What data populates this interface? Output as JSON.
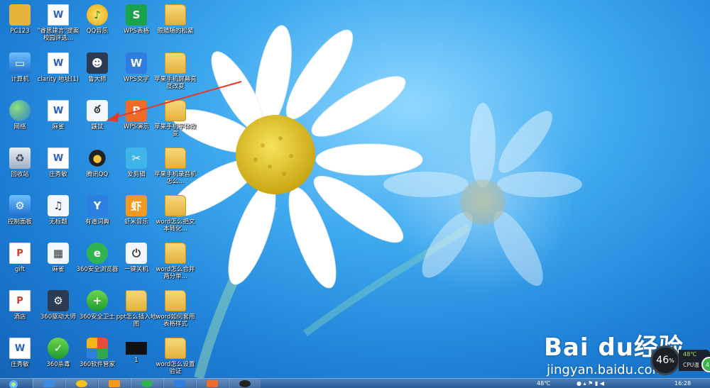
{
  "desktop": {
    "icons": [
      {
        "label": "PC123",
        "glyph": "pc",
        "symbol": "",
        "icon_name": "folder-icon"
      },
      {
        "label": "\"睿思建言\"提案校园评选...",
        "glyph": "doc-w",
        "symbol": "W",
        "icon_name": "word-document-icon"
      },
      {
        "label": "QQ音乐",
        "glyph": "qq",
        "symbol": "♪",
        "icon_name": "qq-music-icon"
      },
      {
        "label": "WPS表格",
        "glyph": "wps-s",
        "symbol": "S",
        "icon_name": "wps-spreadsheet-icon"
      },
      {
        "label": "眼睛随的松紧",
        "glyph": "folder",
        "symbol": "",
        "icon_name": "folder-icon"
      },
      {
        "label": "计算机",
        "glyph": "comp",
        "symbol": "▭",
        "icon_name": "computer-icon"
      },
      {
        "label": "clarity 地址(1)",
        "glyph": "doc-w",
        "symbol": "W",
        "icon_name": "word-document-icon"
      },
      {
        "label": "鲁大师",
        "glyph": "dark",
        "symbol": "☻",
        "icon_name": "ludashi-icon"
      },
      {
        "label": "WPS文字",
        "glyph": "wps-w",
        "symbol": "W",
        "icon_name": "wps-writer-icon"
      },
      {
        "label": "苹果手机屏幕亮度改变",
        "glyph": "folder",
        "symbol": "",
        "icon_name": "folder-icon"
      },
      {
        "label": "网络",
        "glyph": "globe",
        "symbol": "",
        "icon_name": "network-icon"
      },
      {
        "label": "麻雀",
        "glyph": "doc-w",
        "symbol": "W",
        "icon_name": "word-document-icon"
      },
      {
        "label": "鼷鼠",
        "glyph": "white",
        "symbol": "ఠ",
        "icon_name": "mouse-app-icon"
      },
      {
        "label": "WPS演示",
        "glyph": "wps-p",
        "symbol": "P",
        "icon_name": "wps-presentation-icon"
      },
      {
        "label": "苹果手机字体改变",
        "glyph": "folder",
        "symbol": "",
        "icon_name": "folder-icon"
      },
      {
        "label": "回收站",
        "glyph": "bin",
        "symbol": "♻",
        "icon_name": "recycle-bin-icon"
      },
      {
        "label": "庄秀敏",
        "glyph": "doc-w",
        "symbol": "W",
        "icon_name": "word-document-icon"
      },
      {
        "label": "腾讯QQ",
        "glyph": "penguin",
        "symbol": "●",
        "icon_name": "qq-penguin-icon"
      },
      {
        "label": "爱剪辑",
        "glyph": "cyan",
        "symbol": "✂",
        "icon_name": "video-editor-icon"
      },
      {
        "label": "苹果手机录音机怎么...",
        "glyph": "folder",
        "symbol": "",
        "icon_name": "folder-icon"
      },
      {
        "label": "控制面板",
        "glyph": "comp",
        "symbol": "⚙",
        "icon_name": "control-panel-icon"
      },
      {
        "label": "无标题",
        "glyph": "white",
        "symbol": "♫",
        "icon_name": "audio-file-icon"
      },
      {
        "label": "有道词典",
        "glyph": "blue2",
        "symbol": "Y",
        "icon_name": "youdao-dictionary-icon"
      },
      {
        "label": "虾米音乐",
        "glyph": "orange",
        "symbol": "虾",
        "icon_name": "xiami-music-icon"
      },
      {
        "label": "word怎么把文本转化...",
        "glyph": "folder",
        "symbol": "",
        "icon_name": "folder-icon"
      },
      {
        "label": "gift",
        "glyph": "doc-p",
        "symbol": "P",
        "icon_name": "presentation-document-icon"
      },
      {
        "label": "麻雀",
        "glyph": "white",
        "symbol": "▦",
        "icon_name": "image-file-icon"
      },
      {
        "label": "360安全浏览器",
        "glyph": "green",
        "symbol": "e",
        "icon_name": "browser-icon"
      },
      {
        "label": "一键关机",
        "glyph": "white",
        "symbol": "⏻",
        "icon_name": "shutdown-shortcut-icon"
      },
      {
        "label": "word怎么合并两分单...",
        "glyph": "folder",
        "symbol": "",
        "icon_name": "folder-icon"
      },
      {
        "label": "酒店",
        "glyph": "doc-p",
        "symbol": "P",
        "icon_name": "presentation-document-icon"
      },
      {
        "label": "360驱动大师",
        "glyph": "dark",
        "symbol": "⚙",
        "icon_name": "driver-master-icon"
      },
      {
        "label": "360安全卫士",
        "glyph": "green2",
        "symbol": "+",
        "icon_name": "security-guard-icon"
      },
      {
        "label": "ppt怎么插入地图",
        "glyph": "folder",
        "symbol": "",
        "icon_name": "folder-icon"
      },
      {
        "label": "word如何套用表格样式",
        "glyph": "folder",
        "symbol": "",
        "icon_name": "folder-icon"
      },
      {
        "label": "庄秀敏",
        "glyph": "doc-w",
        "symbol": "W",
        "icon_name": "word-document-icon"
      },
      {
        "label": "360杀毒",
        "glyph": "green2",
        "symbol": "✓",
        "icon_name": "antivirus-icon"
      },
      {
        "label": "360软件管家",
        "glyph": "multi",
        "symbol": "",
        "icon_name": "software-manager-icon"
      },
      {
        "label": "1",
        "glyph": "black",
        "symbol": "",
        "icon_name": "image-thumbnail-icon"
      },
      {
        "label": "word怎么设置验证",
        "glyph": "folder",
        "symbol": "",
        "icon_name": "folder-icon"
      }
    ]
  },
  "watermark": {
    "brand": "Bai du经验",
    "url": "jingyan.baidu.com"
  },
  "cpu_widget": {
    "percent": "46",
    "unit": "%",
    "temp": "48℃",
    "label": "CPU温",
    "badge": "47"
  },
  "taskbar": {
    "tray_temp": "48℃",
    "clock": "16:28"
  },
  "colors": {
    "folder": "#e3b23c",
    "taskbar": "#2a5a95",
    "sky": "#1d7fd6"
  }
}
